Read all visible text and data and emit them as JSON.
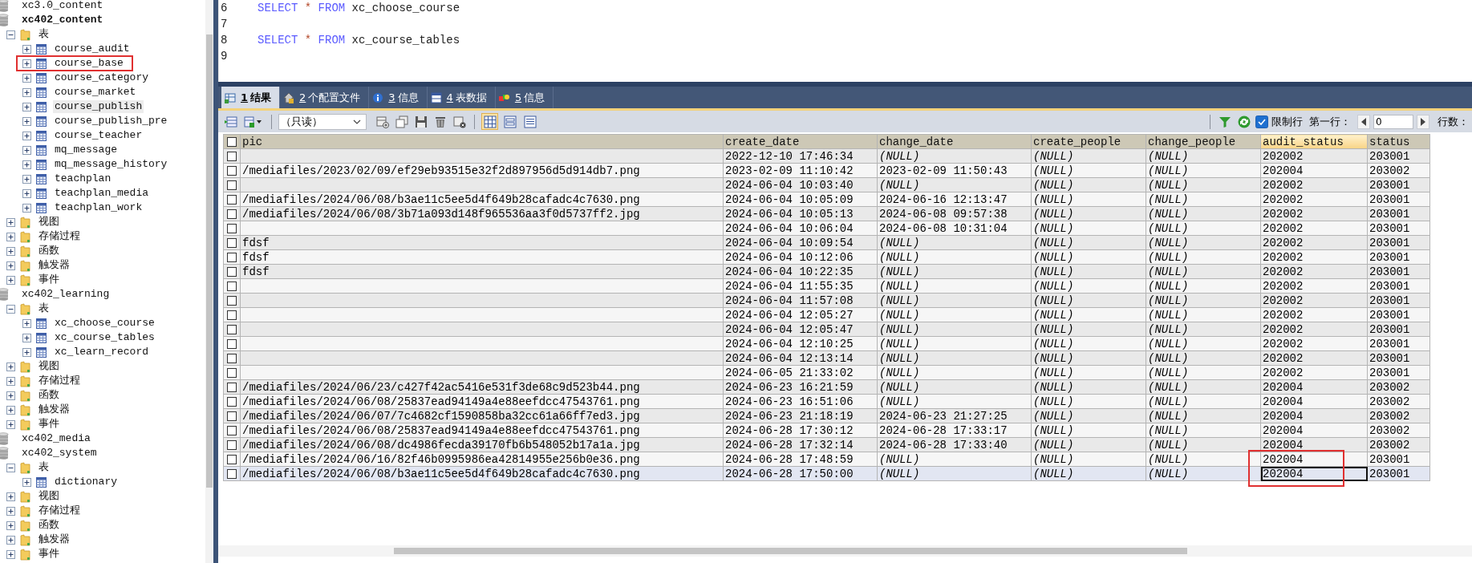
{
  "sidebar": {
    "tree": [
      {
        "kind": "database",
        "label": "xc3.0_content",
        "active": false
      },
      {
        "kind": "database",
        "label": "xc402_content",
        "active": true,
        "children": [
          {
            "kind": "folder",
            "label": "表",
            "expanded": true,
            "children": [
              {
                "kind": "table",
                "label": "course_audit",
                "expanded": false,
                "outlined": false,
                "highlighted": false
              },
              {
                "kind": "table",
                "label": "course_base",
                "expanded": false,
                "outlined": true,
                "highlighted": false
              },
              {
                "kind": "table",
                "label": "course_category",
                "expanded": false,
                "outlined": false,
                "highlighted": false
              },
              {
                "kind": "table",
                "label": "course_market",
                "expanded": false,
                "outlined": false,
                "highlighted": false
              },
              {
                "kind": "table",
                "label": "course_publish",
                "expanded": false,
                "outlined": false,
                "highlighted": true
              },
              {
                "kind": "table",
                "label": "course_publish_pre",
                "expanded": false,
                "outlined": false,
                "highlighted": false
              },
              {
                "kind": "table",
                "label": "course_teacher",
                "expanded": false,
                "outlined": false,
                "highlighted": false
              },
              {
                "kind": "table",
                "label": "mq_message",
                "expanded": false,
                "outlined": false,
                "highlighted": false
              },
              {
                "kind": "table",
                "label": "mq_message_history",
                "expanded": false,
                "outlined": false,
                "highlighted": false
              },
              {
                "kind": "table",
                "label": "teachplan",
                "expanded": false,
                "outlined": false,
                "highlighted": false
              },
              {
                "kind": "table",
                "label": "teachplan_media",
                "expanded": false,
                "outlined": false,
                "highlighted": false
              },
              {
                "kind": "table",
                "label": "teachplan_work",
                "expanded": false,
                "outlined": false,
                "highlighted": false
              }
            ]
          },
          {
            "kind": "folder",
            "label": "视图",
            "expanded": false
          },
          {
            "kind": "folder",
            "label": "存储过程",
            "expanded": false
          },
          {
            "kind": "folder",
            "label": "函数",
            "expanded": false
          },
          {
            "kind": "folder",
            "label": "触发器",
            "expanded": false
          },
          {
            "kind": "folder",
            "label": "事件",
            "expanded": false
          }
        ]
      },
      {
        "kind": "database",
        "label": "xc402_learning",
        "active": false,
        "children": [
          {
            "kind": "folder",
            "label": "表",
            "expanded": true,
            "children": [
              {
                "kind": "table",
                "label": "xc_choose_course",
                "expanded": false,
                "outlined": false,
                "highlighted": false
              },
              {
                "kind": "table",
                "label": "xc_course_tables",
                "expanded": false,
                "outlined": false,
                "highlighted": false
              },
              {
                "kind": "table",
                "label": "xc_learn_record",
                "expanded": false,
                "outlined": false,
                "highlighted": false
              }
            ]
          },
          {
            "kind": "folder",
            "label": "视图",
            "expanded": false
          },
          {
            "kind": "folder",
            "label": "存储过程",
            "expanded": false
          },
          {
            "kind": "folder",
            "label": "函数",
            "expanded": false
          },
          {
            "kind": "folder",
            "label": "触发器",
            "expanded": false
          },
          {
            "kind": "folder",
            "label": "事件",
            "expanded": false
          }
        ]
      },
      {
        "kind": "database",
        "label": "xc402_media",
        "active": false
      },
      {
        "kind": "database",
        "label": "xc402_system",
        "active": false,
        "children": [
          {
            "kind": "folder",
            "label": "表",
            "expanded": true,
            "children": [
              {
                "kind": "table",
                "label": "dictionary",
                "expanded": false,
                "outlined": false,
                "highlighted": false
              }
            ]
          },
          {
            "kind": "folder",
            "label": "视图",
            "expanded": false
          },
          {
            "kind": "folder",
            "label": "存储过程",
            "expanded": false
          },
          {
            "kind": "folder",
            "label": "函数",
            "expanded": false
          },
          {
            "kind": "folder",
            "label": "触发器",
            "expanded": false
          },
          {
            "kind": "folder",
            "label": "事件",
            "expanded": false
          }
        ]
      }
    ]
  },
  "editor": {
    "lines": [
      {
        "number": "6",
        "tokens": [
          {
            "text": "SELECT",
            "kind": "keyword"
          },
          {
            "text": "*",
            "kind": "operator"
          },
          {
            "text": "FROM",
            "kind": "keyword"
          },
          {
            "text": "xc_choose_course",
            "kind": "identifier"
          }
        ]
      },
      {
        "number": "7"
      },
      {
        "number": "8",
        "tokens": [
          {
            "text": "SELECT",
            "kind": "keyword"
          },
          {
            "text": "*",
            "kind": "operator"
          },
          {
            "text": "FROM",
            "kind": "keyword"
          },
          {
            "text": "xc_course_tables",
            "kind": "identifier"
          }
        ]
      },
      {
        "number": "9"
      }
    ]
  },
  "result_tabs": [
    {
      "number": "1",
      "label": "结果",
      "selected": true
    },
    {
      "number": "2",
      "label": "个配置文件",
      "selected": false
    },
    {
      "number": "3",
      "label": "信息",
      "selected": false
    },
    {
      "number": "4",
      "label": "表数据",
      "selected": false
    },
    {
      "number": "5",
      "label": "信息",
      "selected": false
    }
  ],
  "toolbar": {
    "mode": "（只读）",
    "views": [
      {
        "selected": true
      },
      {
        "selected": false
      },
      {
        "selected": false
      }
    ],
    "limit_rows": {
      "label": "限制行",
      "checked": true
    },
    "first_row_label": "第一行：",
    "first_row_value": "0",
    "row_count_label": "行数："
  },
  "table": {
    "all_checked": false,
    "columns": [
      {
        "label": "pic",
        "current": false
      },
      {
        "label": "create_date",
        "current": false
      },
      {
        "label": "change_date",
        "current": false
      },
      {
        "label": "create_people",
        "current": false
      },
      {
        "label": "change_people",
        "current": false
      },
      {
        "label": "audit_status",
        "current": true
      },
      {
        "label": "status",
        "current": false
      }
    ],
    "rows": [
      {
        "checked": false,
        "selected": false,
        "marked": false,
        "cells": [
          null,
          "2022-12-10 17:46:34",
          {
            "text": "(NULL)",
            "kind": "null"
          },
          {
            "text": "(NULL)",
            "kind": "null"
          },
          {
            "text": "(NULL)",
            "kind": "null"
          },
          "202002",
          "203001"
        ]
      },
      {
        "checked": false,
        "selected": false,
        "marked": false,
        "cells": [
          "/mediafiles/2023/02/09/ef29eb93515e32f2d897956d5d914db7.png",
          "2023-02-09 11:10:42",
          "2023-02-09 11:50:43",
          {
            "text": "(NULL)",
            "kind": "null"
          },
          {
            "text": "(NULL)",
            "kind": "null"
          },
          "202004",
          "203002"
        ]
      },
      {
        "checked": false,
        "selected": false,
        "marked": false,
        "cells": [
          null,
          "2024-06-04 10:03:40",
          {
            "text": "(NULL)",
            "kind": "null"
          },
          {
            "text": "(NULL)",
            "kind": "null"
          },
          {
            "text": "(NULL)",
            "kind": "null"
          },
          "202002",
          "203001"
        ]
      },
      {
        "checked": false,
        "selected": false,
        "marked": false,
        "cells": [
          "/mediafiles/2024/06/08/b3ae11c5ee5d4f649b28cafadc4c7630.png",
          "2024-06-04 10:05:09",
          "2024-06-16 12:13:47",
          {
            "text": "(NULL)",
            "kind": "null"
          },
          {
            "text": "(NULL)",
            "kind": "null"
          },
          "202002",
          "203001"
        ]
      },
      {
        "checked": false,
        "selected": false,
        "marked": false,
        "cells": [
          "/mediafiles/2024/06/08/3b71a093d148f965536aa3f0d5737ff2.jpg",
          "2024-06-04 10:05:13",
          "2024-06-08 09:57:38",
          {
            "text": "(NULL)",
            "kind": "null"
          },
          {
            "text": "(NULL)",
            "kind": "null"
          },
          "202002",
          "203001"
        ]
      },
      {
        "checked": false,
        "selected": false,
        "marked": false,
        "cells": [
          null,
          "2024-06-04 10:06:04",
          "2024-06-08 10:31:04",
          {
            "text": "(NULL)",
            "kind": "null"
          },
          {
            "text": "(NULL)",
            "kind": "null"
          },
          "202002",
          "203001"
        ]
      },
      {
        "checked": false,
        "selected": false,
        "marked": false,
        "cells": [
          "fdsf",
          "2024-06-04 10:09:54",
          {
            "text": "(NULL)",
            "kind": "null"
          },
          {
            "text": "(NULL)",
            "kind": "null"
          },
          {
            "text": "(NULL)",
            "kind": "null"
          },
          "202002",
          "203001"
        ]
      },
      {
        "checked": false,
        "selected": false,
        "marked": false,
        "cells": [
          "fdsf",
          "2024-06-04 10:12:06",
          {
            "text": "(NULL)",
            "kind": "null"
          },
          {
            "text": "(NULL)",
            "kind": "null"
          },
          {
            "text": "(NULL)",
            "kind": "null"
          },
          "202002",
          "203001"
        ]
      },
      {
        "checked": false,
        "selected": false,
        "marked": false,
        "cells": [
          "fdsf",
          "2024-06-04 10:22:35",
          {
            "text": "(NULL)",
            "kind": "null"
          },
          {
            "text": "(NULL)",
            "kind": "null"
          },
          {
            "text": "(NULL)",
            "kind": "null"
          },
          "202002",
          "203001"
        ]
      },
      {
        "checked": false,
        "selected": false,
        "marked": false,
        "cells": [
          null,
          "2024-06-04 11:55:35",
          {
            "text": "(NULL)",
            "kind": "null"
          },
          {
            "text": "(NULL)",
            "kind": "null"
          },
          {
            "text": "(NULL)",
            "kind": "null"
          },
          "202002",
          "203001"
        ]
      },
      {
        "checked": false,
        "selected": false,
        "marked": false,
        "cells": [
          null,
          "2024-06-04 11:57:08",
          {
            "text": "(NULL)",
            "kind": "null"
          },
          {
            "text": "(NULL)",
            "kind": "null"
          },
          {
            "text": "(NULL)",
            "kind": "null"
          },
          "202002",
          "203001"
        ]
      },
      {
        "checked": false,
        "selected": false,
        "marked": false,
        "cells": [
          null,
          "2024-06-04 12:05:27",
          {
            "text": "(NULL)",
            "kind": "null"
          },
          {
            "text": "(NULL)",
            "kind": "null"
          },
          {
            "text": "(NULL)",
            "kind": "null"
          },
          "202002",
          "203001"
        ]
      },
      {
        "checked": false,
        "selected": false,
        "marked": false,
        "cells": [
          null,
          "2024-06-04 12:05:47",
          {
            "text": "(NULL)",
            "kind": "null"
          },
          {
            "text": "(NULL)",
            "kind": "null"
          },
          {
            "text": "(NULL)",
            "kind": "null"
          },
          "202002",
          "203001"
        ]
      },
      {
        "checked": false,
        "selected": false,
        "marked": false,
        "cells": [
          null,
          "2024-06-04 12:10:25",
          {
            "text": "(NULL)",
            "kind": "null"
          },
          {
            "text": "(NULL)",
            "kind": "null"
          },
          {
            "text": "(NULL)",
            "kind": "null"
          },
          "202002",
          "203001"
        ]
      },
      {
        "checked": false,
        "selected": false,
        "marked": false,
        "cells": [
          null,
          "2024-06-04 12:13:14",
          {
            "text": "(NULL)",
            "kind": "null"
          },
          {
            "text": "(NULL)",
            "kind": "null"
          },
          {
            "text": "(NULL)",
            "kind": "null"
          },
          "202002",
          "203001"
        ]
      },
      {
        "checked": false,
        "selected": false,
        "marked": false,
        "cells": [
          null,
          "2024-06-05 21:33:02",
          {
            "text": "(NULL)",
            "kind": "null"
          },
          {
            "text": "(NULL)",
            "kind": "null"
          },
          {
            "text": "(NULL)",
            "kind": "null"
          },
          "202002",
          "203001"
        ]
      },
      {
        "checked": false,
        "selected": false,
        "marked": false,
        "cells": [
          "/mediafiles/2024/06/23/c427f42ac5416e531f3de68c9d523b44.png",
          "2024-06-23 16:21:59",
          {
            "text": "(NULL)",
            "kind": "null"
          },
          {
            "text": "(NULL)",
            "kind": "null"
          },
          {
            "text": "(NULL)",
            "kind": "null"
          },
          "202004",
          "203002"
        ]
      },
      {
        "checked": false,
        "selected": false,
        "marked": false,
        "cells": [
          "/mediafiles/2024/06/08/25837ead94149a4e88eefdcc47543761.png",
          "2024-06-23 16:51:06",
          {
            "text": "(NULL)",
            "kind": "null"
          },
          {
            "text": "(NULL)",
            "kind": "null"
          },
          {
            "text": "(NULL)",
            "kind": "null"
          },
          "202004",
          "203002"
        ]
      },
      {
        "checked": false,
        "selected": false,
        "marked": false,
        "cells": [
          "/mediafiles/2024/06/07/7c4682cf1590858ba32cc61a66ff7ed3.jpg",
          "2024-06-23 21:18:19",
          "2024-06-23 21:27:25",
          {
            "text": "(NULL)",
            "kind": "null"
          },
          {
            "text": "(NULL)",
            "kind": "null"
          },
          "202004",
          "203002"
        ]
      },
      {
        "checked": false,
        "selected": false,
        "marked": false,
        "cells": [
          "/mediafiles/2024/06/08/25837ead94149a4e88eefdcc47543761.png",
          "2024-06-28 17:30:12",
          "2024-06-28 17:33:17",
          {
            "text": "(NULL)",
            "kind": "null"
          },
          {
            "text": "(NULL)",
            "kind": "null"
          },
          "202004",
          "203002"
        ]
      },
      {
        "checked": false,
        "selected": false,
        "marked": false,
        "cells": [
          "/mediafiles/2024/06/08/dc4986fecda39170fb6b548052b17a1a.jpg",
          "2024-06-28 17:32:14",
          "2024-06-28 17:33:40",
          {
            "text": "(NULL)",
            "kind": "null"
          },
          {
            "text": "(NULL)",
            "kind": "null"
          },
          "202004",
          "203002"
        ]
      },
      {
        "checked": false,
        "selected": false,
        "marked": true,
        "cells": [
          "/mediafiles/2024/06/16/82f46b0995986ea42814955e256b0e36.png",
          "2024-06-28 17:48:59",
          {
            "text": "(NULL)",
            "kind": "null"
          },
          {
            "text": "(NULL)",
            "kind": "null"
          },
          {
            "text": "(NULL)",
            "kind": "null"
          },
          "202004",
          "203001"
        ]
      },
      {
        "checked": false,
        "selected": true,
        "marked": true,
        "cells": [
          "/mediafiles/2024/06/08/b3ae11c5ee5d4f649b28cafadc4c7630.png",
          "2024-06-28 17:50:00",
          {
            "text": "(NULL)",
            "kind": "null"
          },
          {
            "text": "(NULL)",
            "kind": "null"
          },
          {
            "text": "(NULL)",
            "kind": "null"
          },
          "202004",
          "203001"
        ]
      }
    ]
  }
}
